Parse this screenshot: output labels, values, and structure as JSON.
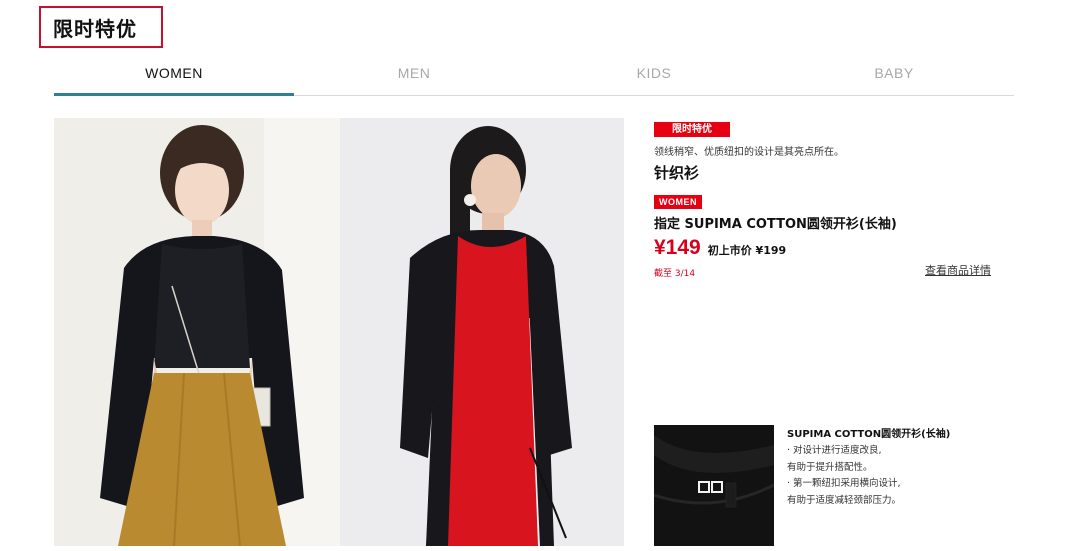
{
  "page": {
    "title": "限时特优"
  },
  "tabs": [
    {
      "label": "WOMEN",
      "active": true
    },
    {
      "label": "MEN",
      "active": false
    },
    {
      "label": "KIDS",
      "active": false
    },
    {
      "label": "BABY",
      "active": false
    }
  ],
  "product": {
    "promo_badge": "限时特优",
    "tagline": "领线稍窄、优质纽扣的设计是其亮点所在。",
    "category": "针织衫",
    "gender_badge": "WOMEN",
    "name": "指定 SUPIMA COTTON圆领开衫(长袖)",
    "price": "¥149",
    "original_price": "初上市价 ¥199",
    "deadline": "截至 3/14",
    "detail_link": "查看商品详情"
  },
  "detail": {
    "title": "SUPIMA COTTON圆领开衫(长袖)",
    "lines": [
      "· 对设计进行适度改良,",
      "  有助于提升搭配性。",
      "· 第一颗纽扣采用横向设计,",
      "  有助于适度减轻颈部压力。"
    ]
  },
  "colors": {
    "accent_red": "#e60012",
    "price_red": "#d8001a",
    "tab_indicator": "#2f7f97",
    "title_border": "#c8102e"
  },
  "images": {
    "left_photo": "model-black-cardigan-mustard-skirt",
    "right_photo": "model-black-cardigan-red-dress",
    "detail_photo": "cardigan-neck-label-closeup"
  }
}
